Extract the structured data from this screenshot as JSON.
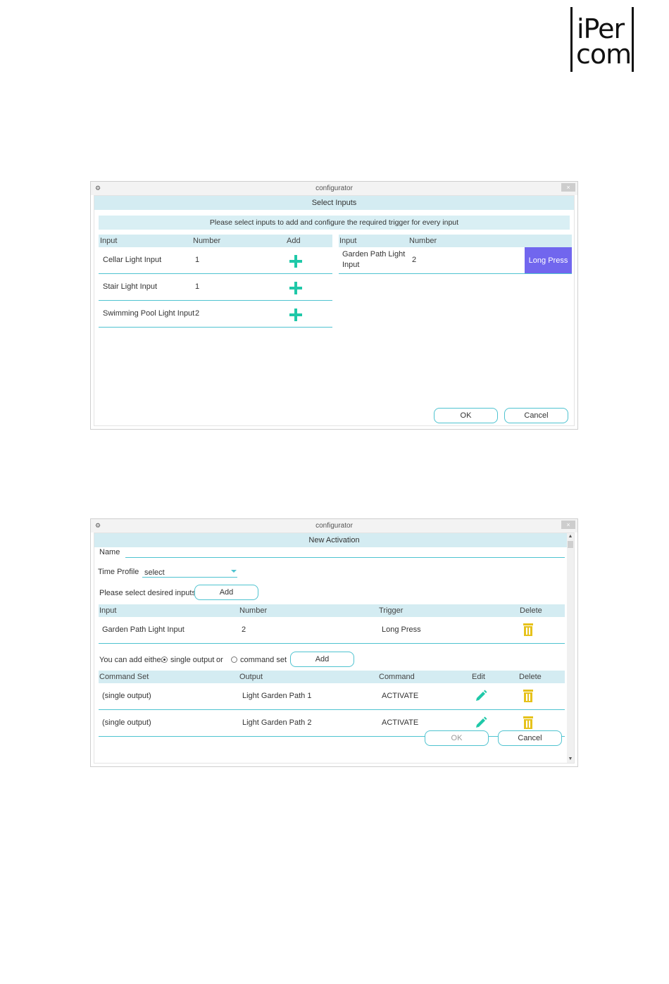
{
  "logo": {
    "line1": "iPer",
    "line2": "com"
  },
  "dialog1": {
    "window_title": "configurator",
    "close_glyph": "×",
    "header": "Select Inputs",
    "banner": "Please select inputs to add and configure the required trigger for every input",
    "left_table": {
      "columns": [
        "Input",
        "Number",
        "Add"
      ],
      "rows": [
        {
          "input": "Cellar Light Input",
          "number": "1"
        },
        {
          "input": "Stair Light Input",
          "number": "1"
        },
        {
          "input": "Swimming Pool Light Input",
          "number": "2"
        }
      ]
    },
    "right_table": {
      "columns": [
        "Input",
        "Number"
      ],
      "rows": [
        {
          "input_line1": "Garden Path Light",
          "input_line2": "Input",
          "number": "2",
          "trigger": "Long Press"
        }
      ]
    },
    "ok_label": "OK",
    "cancel_label": "Cancel",
    "colors": {
      "accent": "#4fc3d0",
      "header_bg": "#d4ecf2",
      "add_icon": "#1fc8a8",
      "trigger_button": "#7166ee"
    }
  },
  "dialog2": {
    "window_title": "configurator",
    "close_glyph": "×",
    "header": "New Activation",
    "name_label": "Name",
    "time_profile_label": "Time Profile",
    "time_profile_value": "select",
    "select_inputs_label": "Please select desired inputs",
    "add_inputs_label": "Add",
    "inputs_table": {
      "columns": [
        "Input",
        "Number",
        "Trigger",
        "Delete"
      ],
      "rows": [
        {
          "input": "Garden Path Light Input",
          "number": "2",
          "trigger": "Long Press"
        }
      ]
    },
    "add_either_label": "You can add either",
    "option_single": "single output",
    "or_label": "or",
    "option_command": "command set",
    "add_output_label": "Add",
    "commands_table": {
      "columns": [
        "Command Set",
        "Output",
        "Command",
        "Edit",
        "Delete"
      ],
      "rows": [
        {
          "command_set": "(single output)",
          "output": "Light Garden Path 1",
          "command": "ACTIVATE"
        },
        {
          "command_set": "(single output)",
          "output": "Light Garden Path 2",
          "command": "ACTIVATE"
        }
      ]
    },
    "ok_label": "OK",
    "cancel_label": "Cancel",
    "colors": {
      "accent": "#4fc3d0",
      "edit_icon": "#1fc8a8",
      "delete_icon": "#e6c21c"
    }
  }
}
